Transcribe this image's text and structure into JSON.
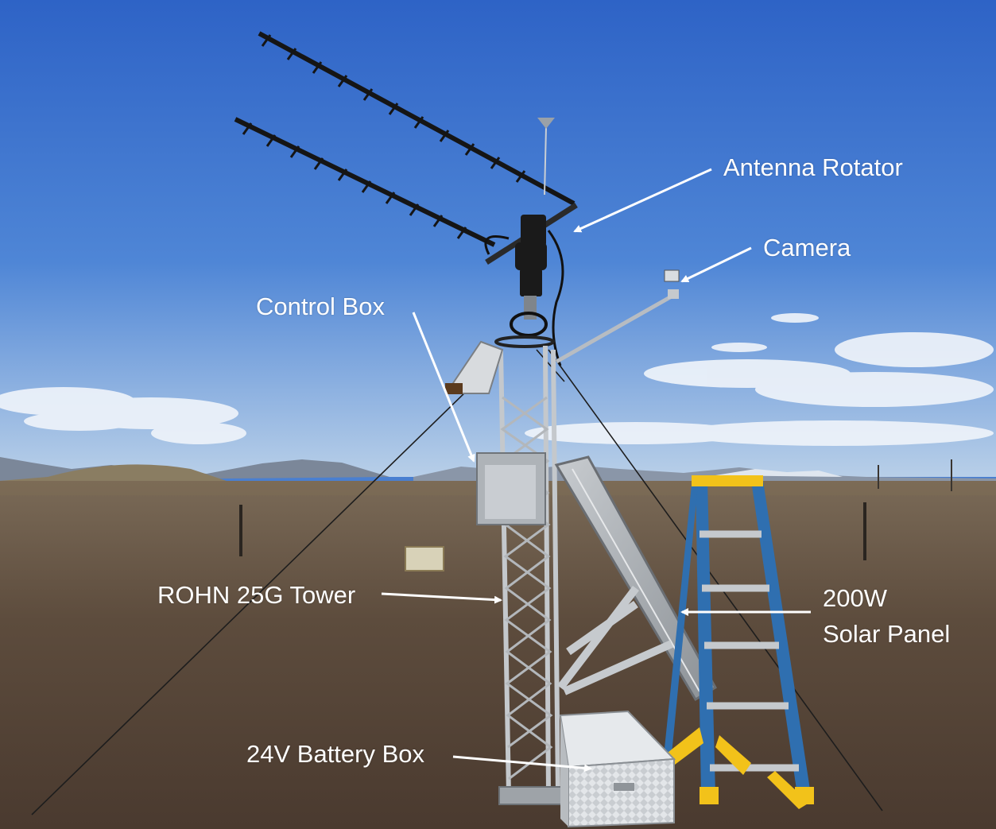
{
  "labels": {
    "antenna_rotator": "Antenna Rotator",
    "camera": "Camera",
    "control_box": "Control Box",
    "tower": "ROHN 25G Tower",
    "solar_panel_line1": "200W",
    "solar_panel_line2": "Solar Panel",
    "battery_box": "24V Battery Box"
  },
  "colors": {
    "sky_top": "#2f66c9",
    "sky_horizon": "#a9c6e6",
    "ground": "#5a4a3c",
    "label_text": "#ffffff",
    "ladder_blue": "#2f6fb0",
    "ladder_yellow": "#f2c21a",
    "metal": "#b9bcc0"
  }
}
